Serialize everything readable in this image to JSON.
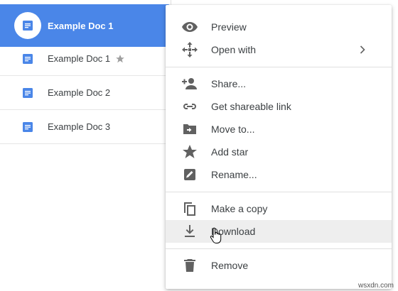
{
  "files": [
    {
      "name": "Example Doc 1",
      "selected": true,
      "starred": false
    },
    {
      "name": "Example Doc 1",
      "selected": false,
      "starred": true
    },
    {
      "name": "Example Doc 2",
      "selected": false,
      "starred": false
    },
    {
      "name": "Example Doc 3",
      "selected": false,
      "starred": false
    }
  ],
  "menu": {
    "preview": "Preview",
    "open_with": "Open with",
    "share": "Share...",
    "get_link": "Get shareable link",
    "move_to": "Move to...",
    "add_star": "Add star",
    "rename": "Rename...",
    "make_copy": "Make a copy",
    "download": "Download",
    "remove": "Remove"
  },
  "colors": {
    "selected_row": "#4a86e8",
    "doc_icon": "#4a86e8",
    "menu_icon": "#616161",
    "hover": "#eeeeee"
  },
  "watermark": "wsxdn.com"
}
